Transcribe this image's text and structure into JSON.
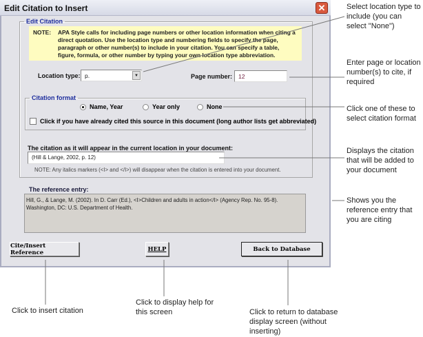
{
  "window": {
    "title": "Edit Citation to Insert",
    "close": "✕"
  },
  "edit_citation": {
    "legend": "Edit Citation",
    "note_label": "NOTE:",
    "note_text": "APA Style calls for including page numbers or other location information when citing a direct quotation. Use the location type and numbering fields to specify the page, paragraph or other number(s) to include in your citation. You can specify a table, figure, formula, or other number by typing your own location type abbreviation.",
    "location_type_label": "Location type:",
    "location_type_value": "p.",
    "page_number_label": "Page number:",
    "page_number_value": "12",
    "format": {
      "legend": "Citation format",
      "options": [
        "Name, Year",
        "Year only",
        "None"
      ],
      "selected": 0,
      "checkbox_label": "Click if you have already cited this source in this document (long author lists get abbreviated)",
      "checked": false
    },
    "citation_label": "The citation as it will appear in the current location in your document:",
    "citation_value": "(Hill & Lange, 2002, p. 12)",
    "italics_note": "NOTE: Any italics markers (<I> and </I>) will disappear when the citation is entered into your document."
  },
  "reference": {
    "label": "The reference entry:",
    "text": "Hill, G., & Lange, M. (2002). In D. Carr (Ed.), <I>Children and adults in action</I> (Agency Rep. No. 95-8). Washington, DC: U.S. Department of Health."
  },
  "buttons": {
    "cite": "Cite/Insert Reference",
    "help": "HELP",
    "back": "Back to Database"
  },
  "annotations": {
    "location": "Select location type to include (you can select \"None\")",
    "page": "Enter page or location number(s) to cite, if required",
    "format": "Click one of these to select citation format",
    "citation": "Displays the citation that will be added to your document",
    "reference": "Shows you the reference entry that you are citing",
    "cite": "Click to insert citation",
    "help": "Click to display help for this screen",
    "back": "Click to return to database display screen (without inserting)"
  }
}
